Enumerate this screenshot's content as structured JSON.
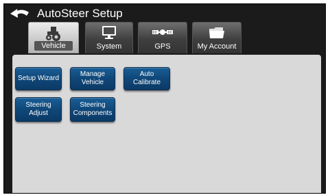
{
  "header": {
    "title": "AutoSteer Setup",
    "back_icon": "back-arrow-icon"
  },
  "tabs": [
    {
      "label": "Vehicle",
      "icon": "tractor-icon",
      "active": true
    },
    {
      "label": "System",
      "icon": "monitor-icon",
      "active": false
    },
    {
      "label": "GPS",
      "icon": "satellite-icon",
      "active": false
    },
    {
      "label": "My Account",
      "icon": "folder-icon",
      "active": false
    }
  ],
  "buttons": {
    "setup_wizard": "Setup Wizard",
    "manage_vehicle": "Manage\nVehicle",
    "auto_calibrate": "Auto Calibrate",
    "steering_adjust": "Steering\nAdjust",
    "steering_components": "Steering\nComponents"
  },
  "colors": {
    "background": "#1b1b1b",
    "panel": "#d9d9d9",
    "button_blue": "#0f4778"
  }
}
